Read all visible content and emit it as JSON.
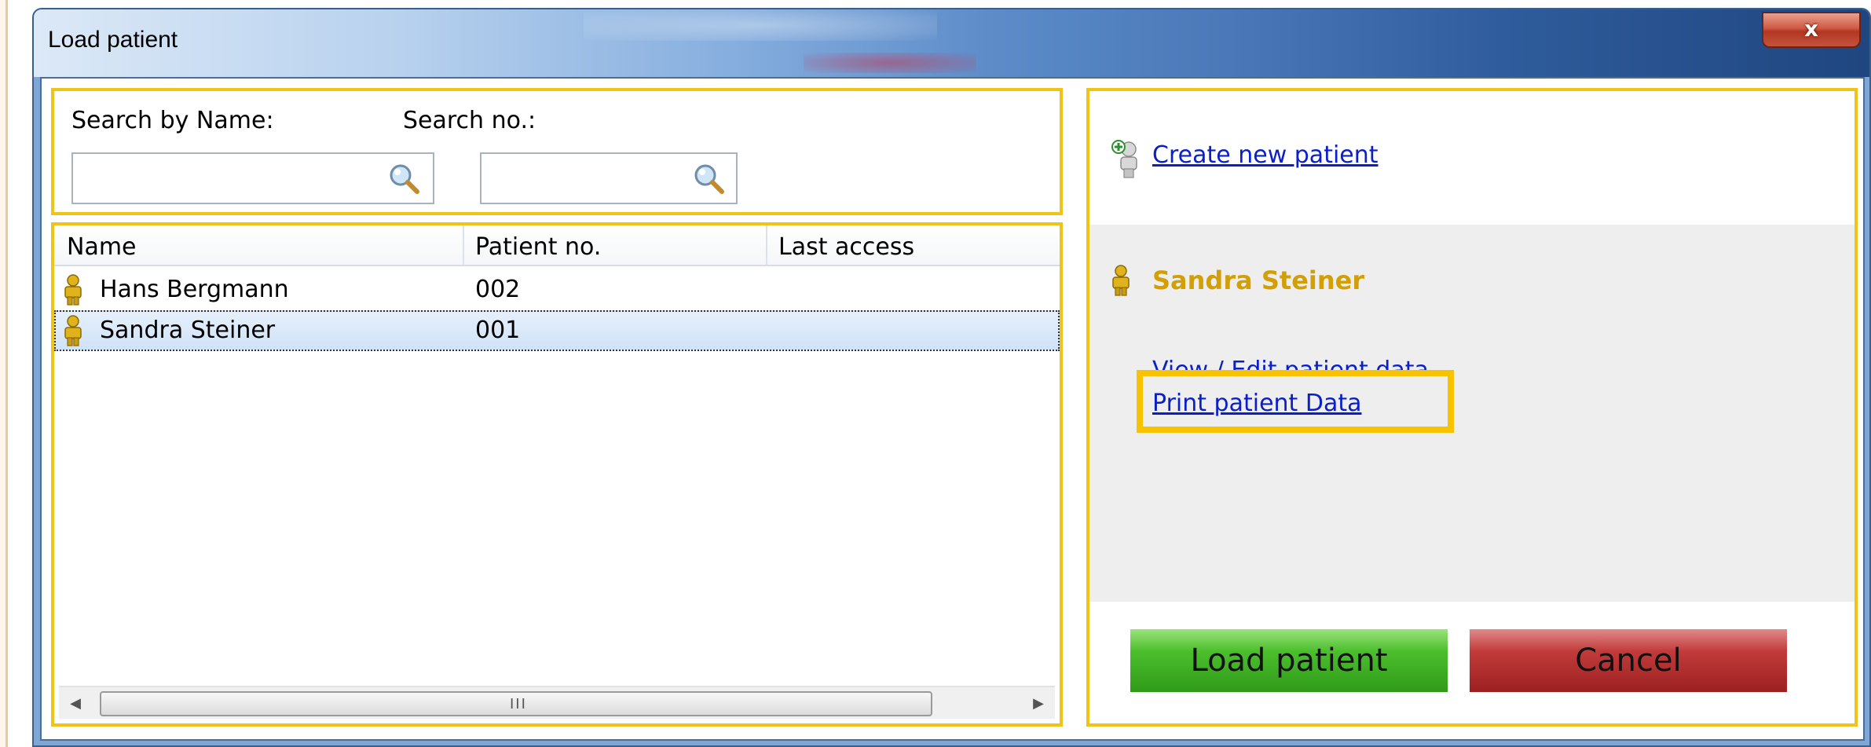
{
  "window": {
    "title": "Load patient",
    "close_label": "x"
  },
  "search": {
    "name_label": "Search by Name:",
    "name_value": "",
    "number_label": "Search no.:",
    "number_value": ""
  },
  "patient_list": {
    "columns": [
      "Name",
      "Patient no.",
      "Last access"
    ],
    "rows": [
      {
        "name": "Hans Bergmann",
        "number": "002",
        "last_access": "",
        "selected": false
      },
      {
        "name": "Sandra Steiner",
        "number": "001",
        "last_access": "",
        "selected": true
      }
    ],
    "scroll_grip": "III"
  },
  "actions": {
    "create_new": "Create new patient",
    "selected_patient": "Sandra Steiner",
    "view_edit": "View / Edit patient data",
    "print": "Print patient Data"
  },
  "buttons": {
    "load": "Load patient",
    "cancel": "Cancel"
  },
  "colors": {
    "panel_border": "#f0c416",
    "highlight": "#f7c200",
    "link": "#0a1fc8",
    "patient_name": "#d39f06",
    "load_button": "#4cbf2e",
    "cancel_button": "#c23b3b"
  }
}
